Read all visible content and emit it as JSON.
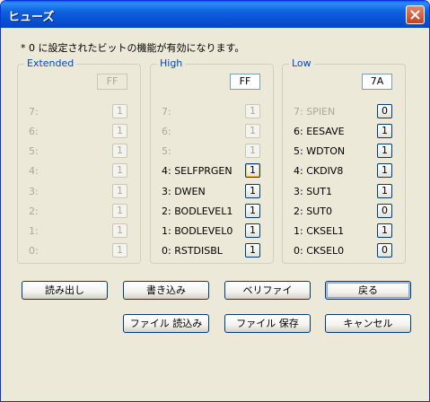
{
  "window": {
    "title": "ヒューズ"
  },
  "note": "* 0 に設定されたビットの機能が有効になります。",
  "groups": {
    "extended": {
      "label": "Extended",
      "hex": "FF",
      "bits": [
        {
          "label": "7:",
          "value": "1"
        },
        {
          "label": "6:",
          "value": "1"
        },
        {
          "label": "5:",
          "value": "1"
        },
        {
          "label": "4:",
          "value": "1"
        },
        {
          "label": "3:",
          "value": "1"
        },
        {
          "label": "2:",
          "value": "1"
        },
        {
          "label": "1:",
          "value": "1"
        },
        {
          "label": "0:",
          "value": "1"
        }
      ]
    },
    "high": {
      "label": "High",
      "hex": "FF",
      "bits": [
        {
          "label": "7:",
          "value": "1"
        },
        {
          "label": "6:",
          "value": "1"
        },
        {
          "label": "5:",
          "value": "1"
        },
        {
          "label": "4: SELFPRGEN",
          "value": "1"
        },
        {
          "label": "3: DWEN",
          "value": "1"
        },
        {
          "label": "2: BODLEVEL1",
          "value": "1"
        },
        {
          "label": "1: BODLEVEL0",
          "value": "1"
        },
        {
          "label": "0: RSTDISBL",
          "value": "1"
        }
      ]
    },
    "low": {
      "label": "Low",
      "hex": "7A",
      "bits": [
        {
          "label": "7: SPIEN",
          "value": "0"
        },
        {
          "label": "6: EESAVE",
          "value": "1"
        },
        {
          "label": "5: WDTON",
          "value": "1"
        },
        {
          "label": "4: CKDIV8",
          "value": "1"
        },
        {
          "label": "3: SUT1",
          "value": "1"
        },
        {
          "label": "2: SUT0",
          "value": "0"
        },
        {
          "label": "1: CKSEL1",
          "value": "1"
        },
        {
          "label": "0: CKSEL0",
          "value": "0"
        }
      ]
    }
  },
  "buttons": {
    "read": "読み出し",
    "write": "書き込み",
    "verify": "ベリファイ",
    "back": "戻る",
    "file_read": "ファイル 読込み",
    "file_save": "ファイル 保存",
    "cancel": "キャンセル"
  }
}
